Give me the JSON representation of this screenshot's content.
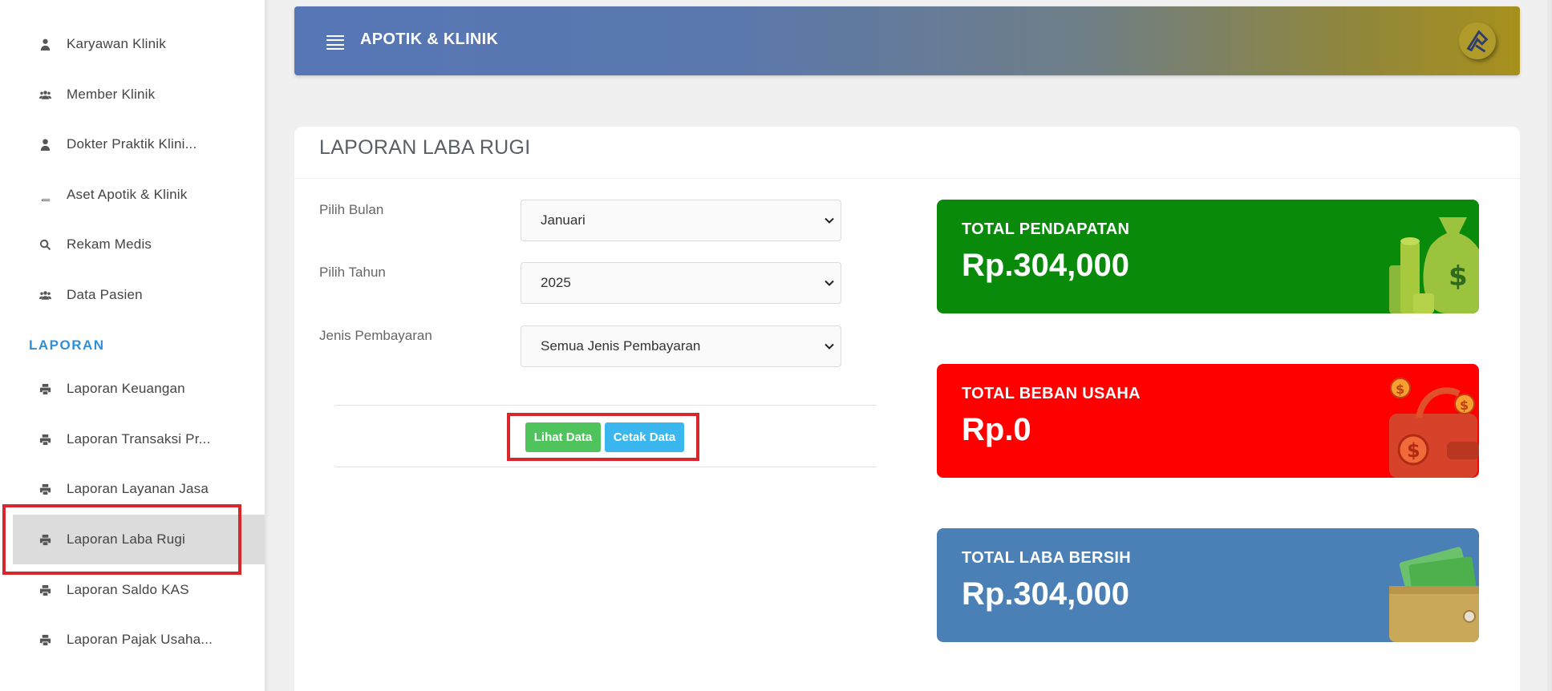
{
  "sidebar": {
    "items_top": [
      {
        "label": "Karyawan Klinik",
        "icon": "user-tie-icon"
      },
      {
        "label": "Member Klinik",
        "icon": "users-icon"
      },
      {
        "label": "Dokter Praktik Klini...",
        "icon": "user-icon"
      },
      {
        "label": "Aset Apotik & Klinik",
        "icon": "book-icon"
      },
      {
        "label": "Rekam Medis",
        "icon": "search-icon"
      },
      {
        "label": "Data Pasien",
        "icon": "users-icon"
      }
    ],
    "section": "LAPORAN",
    "items_laporan": [
      {
        "label": "Laporan Keuangan",
        "icon": "print-icon"
      },
      {
        "label": "Laporan Transaksi Pr...",
        "icon": "print-icon"
      },
      {
        "label": "Laporan Layanan Jasa",
        "icon": "print-icon"
      },
      {
        "label": "Laporan Laba Rugi",
        "icon": "print-icon",
        "active": true
      },
      {
        "label": "Laporan Saldo KAS",
        "icon": "print-icon"
      },
      {
        "label": "Laporan Pajak Usaha...",
        "icon": "print-icon"
      }
    ]
  },
  "header": {
    "title": "APOTIK & KLINIK"
  },
  "card": {
    "title": "LAPORAN LABA RUGI",
    "form": {
      "month_label": "Pilih Bulan",
      "month_value": "Januari",
      "year_label": "Pilih Tahun",
      "year_value": "2025",
      "payment_label": "Jenis Pembayaran",
      "payment_value": "Semua Jenis Pembayaran"
    },
    "buttons": {
      "view": "Lihat Data",
      "print": "Cetak Data"
    },
    "stats": [
      {
        "label": "TOTAL PENDAPATAN",
        "value": "Rp.304,000",
        "color": "#0a8a0a"
      },
      {
        "label": "TOTAL BEBAN USAHA",
        "value": "Rp.0",
        "color": "#ff0000"
      },
      {
        "label": "TOTAL LABA BERSIH",
        "value": "Rp.304,000",
        "color": "#4a80b5"
      }
    ]
  }
}
